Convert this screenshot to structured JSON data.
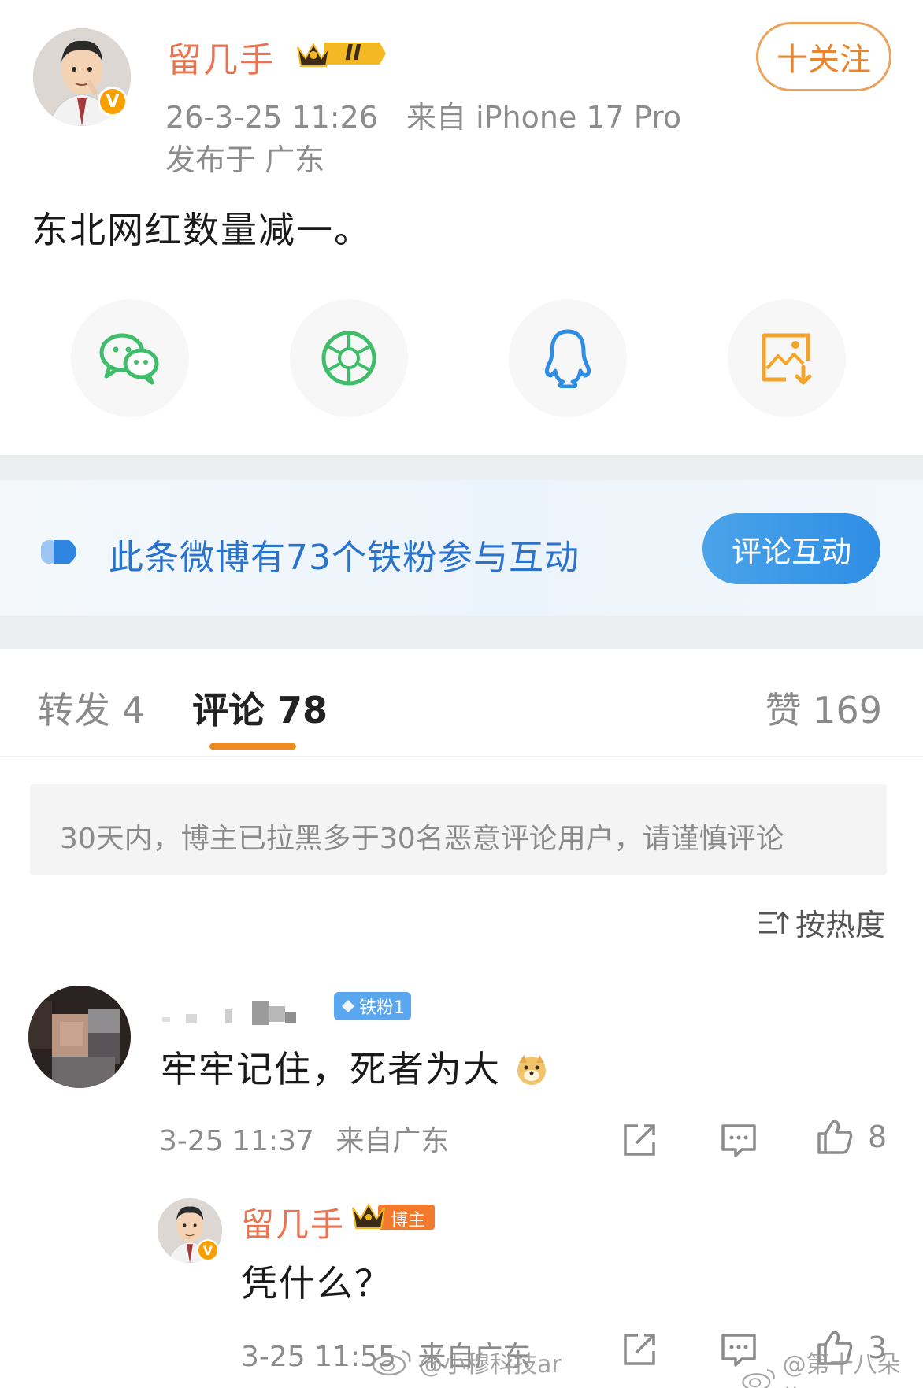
{
  "post": {
    "author": "留几手",
    "level_badge": "II",
    "follow_label": "十关注",
    "timestamp": "26-3-25 11:26",
    "source": "来自 iPhone 17 Pro",
    "location": "发布于 广东",
    "content": "东北网红数量减一。"
  },
  "share": [
    {
      "icon": "wechat-icon",
      "color": "#3fbd6a"
    },
    {
      "icon": "moments-icon",
      "color": "#3fbd6a"
    },
    {
      "icon": "qq-icon",
      "color": "#2f8de4"
    },
    {
      "icon": "save-image-icon",
      "color": "#f3a42c"
    }
  ],
  "fans_banner": {
    "text": "此条微博有73个铁粉参与互动",
    "button": "评论互动"
  },
  "tabs": {
    "repost": "转发 4",
    "comment": "评论 78",
    "like": "赞 169"
  },
  "notice": "30天内，博主已拉黑多于30名恶意评论用户，请谨慎评论",
  "sort": "按热度",
  "comments": [
    {
      "fan_badge": "铁粉1",
      "text": "牢牢记住，死者为大",
      "time": "3-25 11:37",
      "source": "来自广东",
      "likes": "8",
      "reply": {
        "author": "留几手",
        "badge": "博主",
        "text": "凭什么？",
        "time": "3-25 11:55",
        "source": "来自广东",
        "likes": "3"
      }
    }
  ],
  "watermarks": {
    "left": "@小穆科技ar",
    "right": "@第十八朵梅"
  },
  "colors": {
    "name_orange": "#eb7350",
    "follow_orange": "#e8862e",
    "fans_blue": "#2a73cc",
    "tab_underline": "#f08c1d"
  }
}
